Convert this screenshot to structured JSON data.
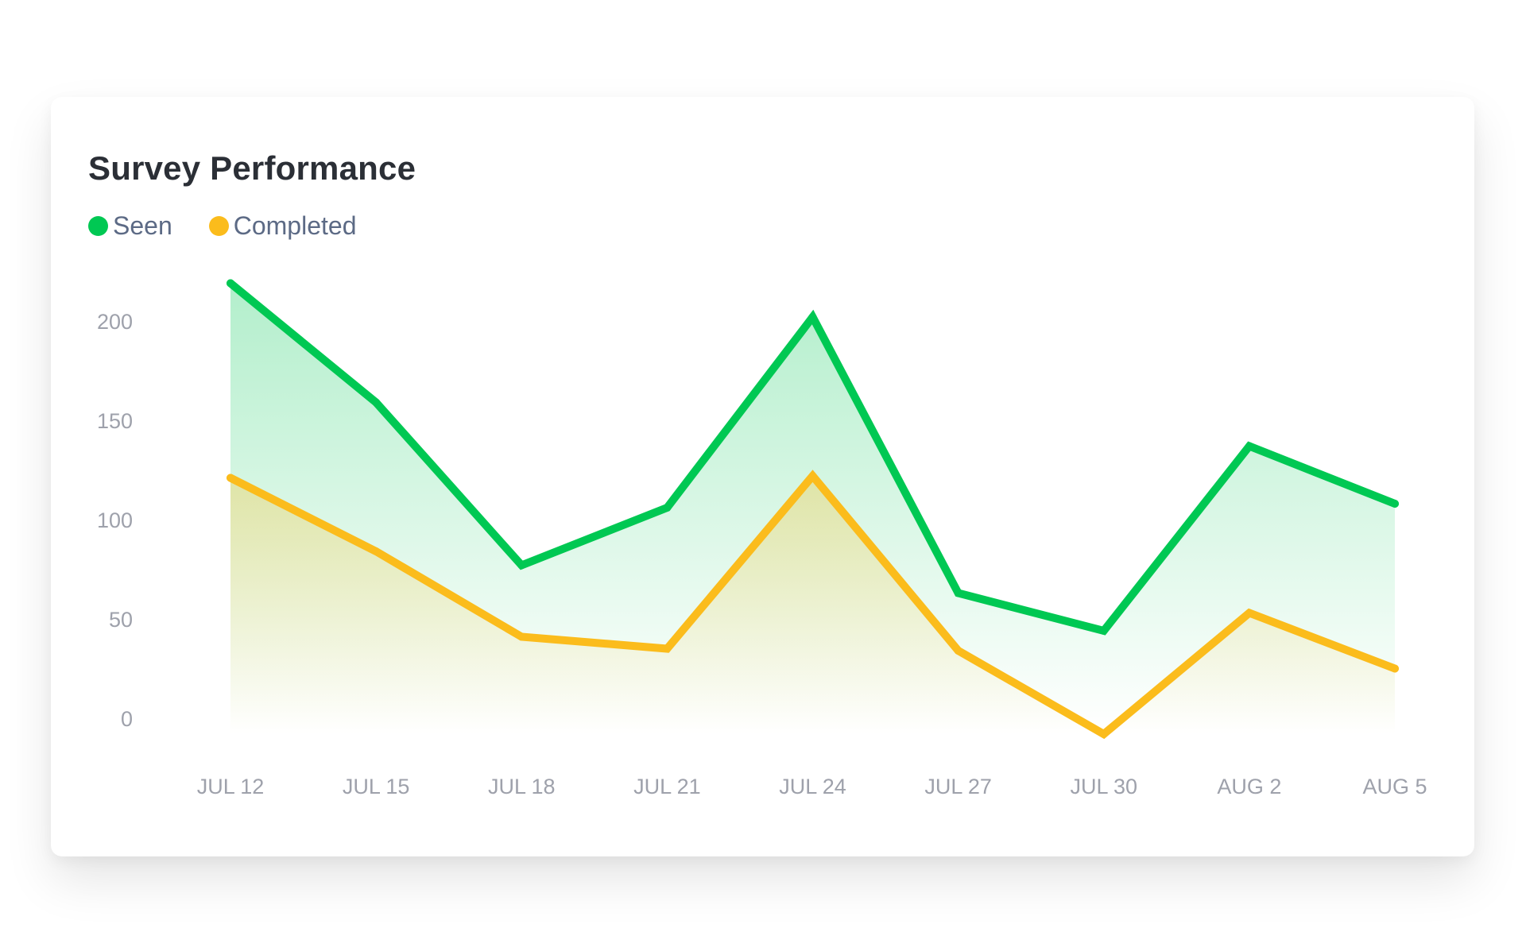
{
  "card": {
    "title": "Survey Performance"
  },
  "legend": [
    {
      "label": "Seen",
      "color": "#00c853"
    },
    {
      "label": "Completed",
      "color": "#fbbc1c"
    }
  ],
  "chart_data": {
    "type": "area",
    "title": "Survey Performance",
    "xlabel": "",
    "ylabel": "",
    "categories": [
      "JUL 12",
      "JUL 15",
      "JUL 18",
      "JUL 21",
      "JUL 24",
      "JUL 27",
      "JUL 30",
      "AUG 2",
      "AUG 5"
    ],
    "series": [
      {
        "name": "Seen",
        "color": "#00c853",
        "values": [
          219,
          159,
          77,
          106,
          202,
          63,
          44,
          137,
          108
        ]
      },
      {
        "name": "Completed",
        "color": "#fbbc1c",
        "values": [
          121,
          84,
          41,
          35,
          122,
          34,
          -8,
          53,
          25
        ]
      }
    ],
    "yticks": [
      0,
      50,
      100,
      150,
      200
    ],
    "ylim": [
      -10,
      220
    ],
    "grid": false,
    "legend_position": "top-left"
  }
}
